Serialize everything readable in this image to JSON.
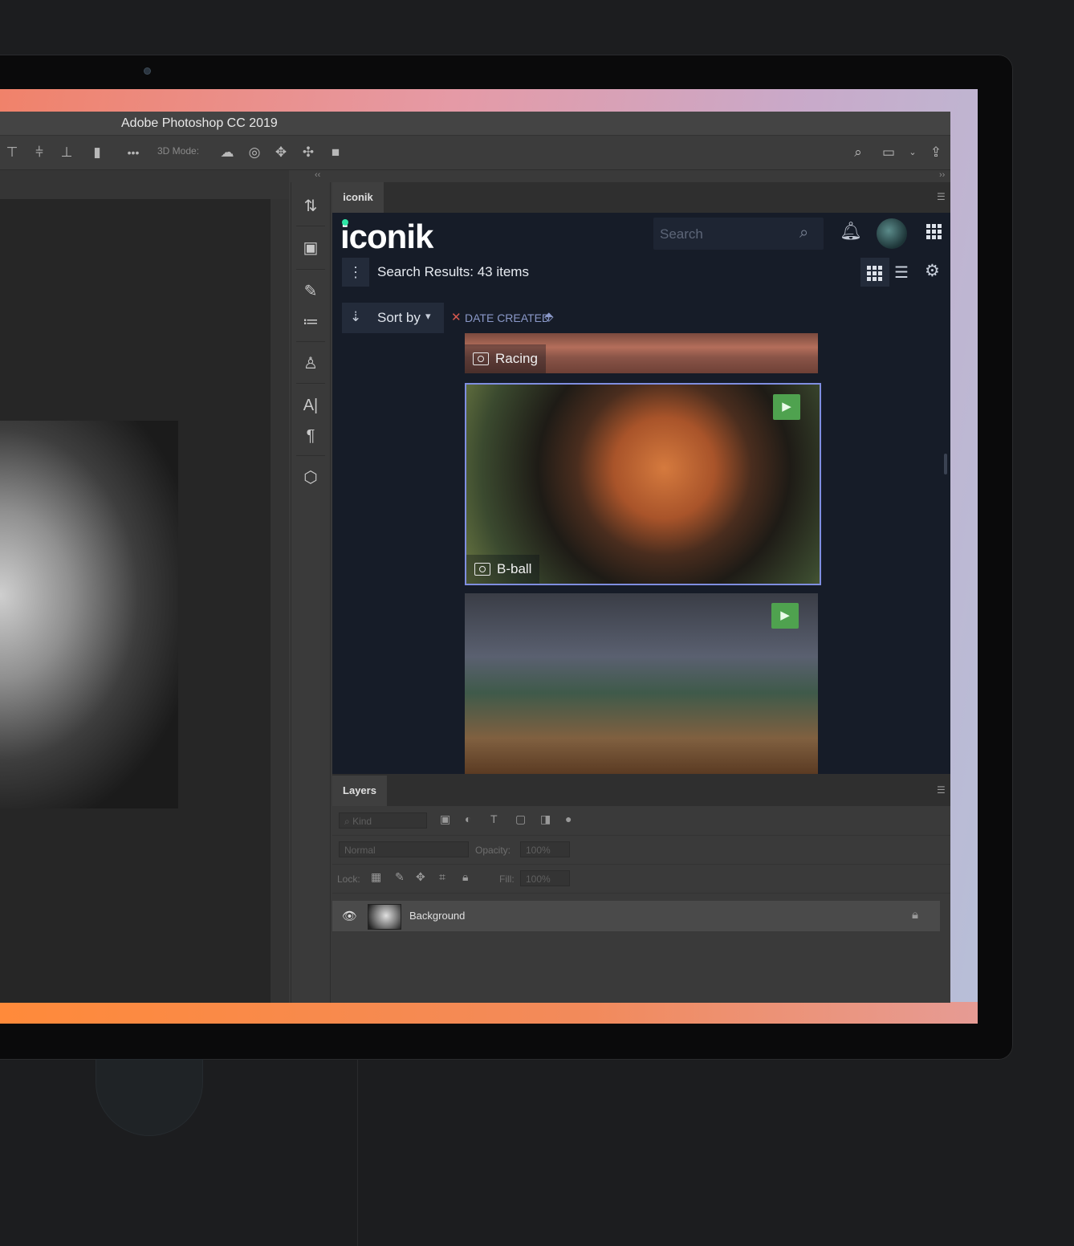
{
  "app": {
    "title": "Adobe Photoshop CC 2019"
  },
  "options_bar": {
    "mode_label": "3D Mode:",
    "more": "•••"
  },
  "iconik_panel": {
    "tab": "iconik",
    "logo": "iconik",
    "search_placeholder": "Search",
    "results_text": "Search Results: 43 items",
    "sort_by": "Sort by",
    "filter_label": "DATE CREATED",
    "cards": [
      {
        "title": "Racing",
        "type": "image"
      },
      {
        "title": "B-ball",
        "type": "image",
        "has_video_badge": true
      },
      {
        "title": "",
        "type": "image",
        "has_video_badge": true
      }
    ]
  },
  "layers_panel": {
    "tab": "Layers",
    "kind_placeholder": "Kind",
    "blend_mode": "Normal",
    "opacity_label": "Opacity:",
    "opacity_value": "100%",
    "lock_label": "Lock:",
    "fill_label": "Fill:",
    "fill_value": "100%",
    "layers": [
      {
        "name": "Background",
        "locked": true,
        "visible": true
      }
    ]
  },
  "colors": {
    "iconik_bg": "#161c28",
    "accent": "#2ee6a6",
    "selection": "#7f8ee0",
    "video_badge": "#4fa24f",
    "bezel_orange": "#ff8a3a"
  }
}
